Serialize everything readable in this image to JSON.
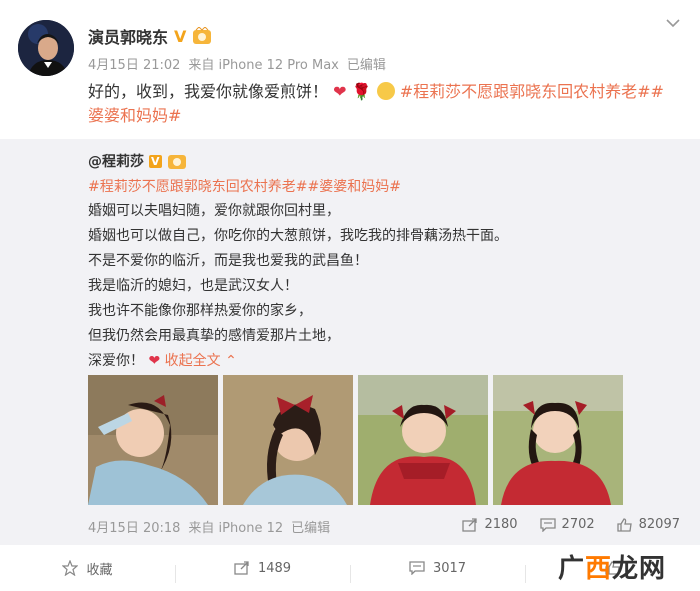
{
  "post": {
    "author": "演员郭晓东",
    "v_badge": "V",
    "time": "4月15日 21:02",
    "source": "来自 iPhone 12 Pro Max",
    "edited": "已编辑",
    "text": "好的，收到，我爱你就像爱煎饼！",
    "topics": "#程莉莎不愿跟郭晓东回农村养老##婆婆和妈妈#"
  },
  "repost": {
    "author": "@程莉莎",
    "v_badge": "V",
    "topics": "#程莉莎不愿跟郭晓东回农村养老##婆婆和妈妈#",
    "lines": [
      "婚姻可以夫唱妇随，爱你就跟你回村里，",
      "婚姻也可以做自己，你吃你的大葱煎饼，我吃我的排骨藕汤热干面。",
      "不是不爱你的临沂，而是我也爱我的武昌鱼！",
      "我是临沂的媳妇，也是武汉女人！",
      "我也许不能像你那样热爱你的家乡，",
      "但我仍然会用最真挚的感情爱那片土地，"
    ],
    "last_line": "深爱你！",
    "collapse": "收起全文",
    "time": "4月15日 20:18",
    "source": "来自 iPhone 12",
    "edited": "已编辑",
    "stats": {
      "forward": "2180",
      "comment": "2702",
      "like": "82097"
    }
  },
  "actions": {
    "favorite": "收藏",
    "forward": "1489",
    "comment": "3017"
  },
  "watermark": {
    "part1": "广",
    "part2": "西",
    "part3": "龙网"
  },
  "colors": {
    "topic": "#eb7350",
    "badge": "#f3a41c",
    "repost_bg": "#f2f2f5",
    "heart": "#e0344b"
  }
}
